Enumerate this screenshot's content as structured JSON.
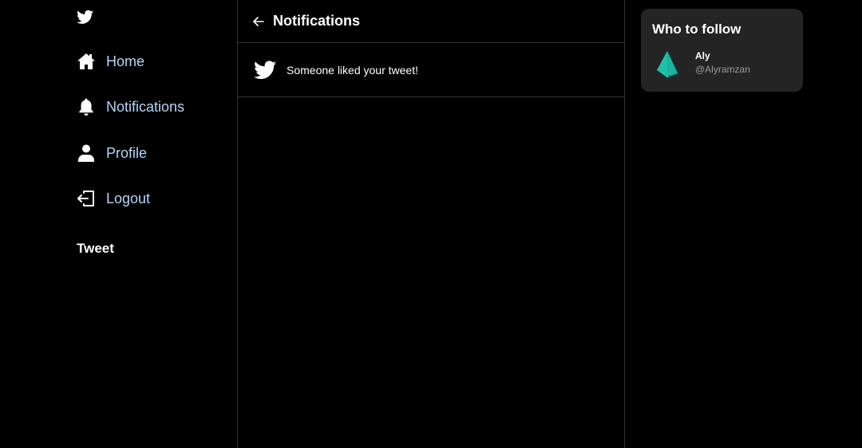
{
  "sidebar": {
    "logo": "twitter-bird-icon",
    "items": [
      {
        "label": "Home",
        "icon": "home-icon"
      },
      {
        "label": "Notifications",
        "icon": "bell-icon"
      },
      {
        "label": "Profile",
        "icon": "user-icon"
      },
      {
        "label": "Logout",
        "icon": "logout-icon"
      }
    ],
    "tweet_label": "Tweet",
    "link_color": "#b3d5f7"
  },
  "main": {
    "header": {
      "title": "Notifications",
      "back_icon": "arrow-left-icon"
    },
    "notifications": [
      {
        "text": "Someone liked your tweet!",
        "icon": "twitter-bird-icon"
      }
    ]
  },
  "who_to_follow": {
    "title": "Who to follow",
    "users": [
      {
        "name": "Aly",
        "handle": "@Alyramzan",
        "avatar": "prisma-logo-icon"
      }
    ]
  },
  "colors": {
    "background": "#000000",
    "card": "#242424",
    "border": "#2f3336",
    "accent": "#1ec1a7"
  }
}
